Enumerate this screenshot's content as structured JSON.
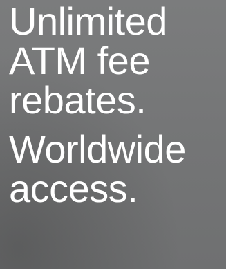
{
  "promo": {
    "headline_lines": [
      "Unlimited",
      "ATM fee",
      "rebates."
    ],
    "subheadline_lines": [
      "Worldwide",
      "access."
    ]
  },
  "colors": {
    "background": "#767778",
    "text": "#ffffff"
  }
}
